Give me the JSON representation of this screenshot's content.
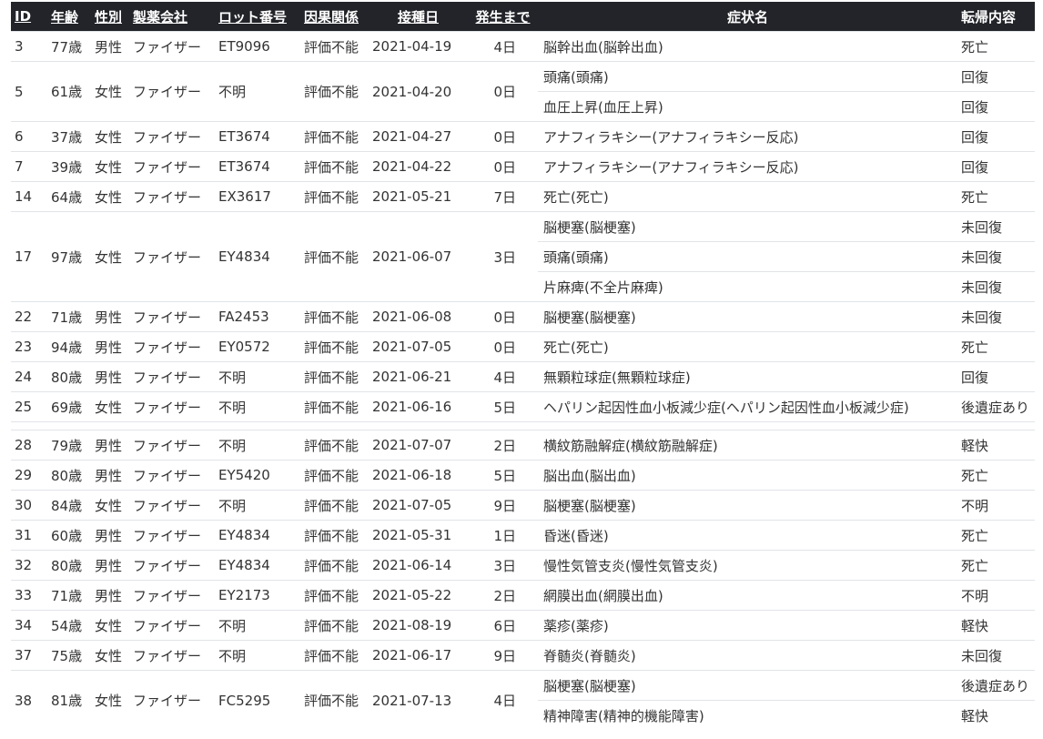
{
  "headers": {
    "id": "ID",
    "age": "年齢",
    "sex": "性別",
    "maker": "製薬会社",
    "lot": "ロット番号",
    "causality": "因果関係",
    "date": "接種日",
    "days": "発生まで",
    "symptom": "症状名",
    "outcome": "転帰内容"
  },
  "records": [
    {
      "id": "3",
      "age": "77歳",
      "sex": "男性",
      "maker": "ファイザー",
      "lot": "ET9096",
      "causality": "評価不能",
      "date": "2021-04-19",
      "days": "4日",
      "symptoms": [
        {
          "name": "脳幹出血(脳幹出血)",
          "outcome": "死亡"
        }
      ]
    },
    {
      "id": "5",
      "age": "61歳",
      "sex": "女性",
      "maker": "ファイザー",
      "lot": "不明",
      "causality": "評価不能",
      "date": "2021-04-20",
      "days": "0日",
      "symptoms": [
        {
          "name": "頭痛(頭痛)",
          "outcome": "回復"
        },
        {
          "name": "血圧上昇(血圧上昇)",
          "outcome": "回復"
        }
      ]
    },
    {
      "id": "6",
      "age": "37歳",
      "sex": "女性",
      "maker": "ファイザー",
      "lot": "ET3674",
      "causality": "評価不能",
      "date": "2021-04-27",
      "days": "0日",
      "symptoms": [
        {
          "name": "アナフィラキシー(アナフィラキシー反応)",
          "outcome": "回復"
        }
      ]
    },
    {
      "id": "7",
      "age": "39歳",
      "sex": "女性",
      "maker": "ファイザー",
      "lot": "ET3674",
      "causality": "評価不能",
      "date": "2021-04-22",
      "days": "0日",
      "symptoms": [
        {
          "name": "アナフィラキシー(アナフィラキシー反応)",
          "outcome": "回復"
        }
      ]
    },
    {
      "id": "14",
      "age": "64歳",
      "sex": "女性",
      "maker": "ファイザー",
      "lot": "EX3617",
      "causality": "評価不能",
      "date": "2021-05-21",
      "days": "7日",
      "symptoms": [
        {
          "name": "死亡(死亡)",
          "outcome": "死亡"
        }
      ]
    },
    {
      "id": "17",
      "age": "97歳",
      "sex": "女性",
      "maker": "ファイザー",
      "lot": "EY4834",
      "causality": "評価不能",
      "date": "2021-06-07",
      "days": "3日",
      "symptoms": [
        {
          "name": "脳梗塞(脳梗塞)",
          "outcome": "未回復"
        },
        {
          "name": "頭痛(頭痛)",
          "outcome": "未回復"
        },
        {
          "name": "片麻痺(不全片麻痺)",
          "outcome": "未回復"
        }
      ]
    },
    {
      "id": "22",
      "age": "71歳",
      "sex": "男性",
      "maker": "ファイザー",
      "lot": "FA2453",
      "causality": "評価不能",
      "date": "2021-06-08",
      "days": "0日",
      "symptoms": [
        {
          "name": "脳梗塞(脳梗塞)",
          "outcome": "未回復"
        }
      ]
    },
    {
      "id": "23",
      "age": "94歳",
      "sex": "男性",
      "maker": "ファイザー",
      "lot": "EY0572",
      "causality": "評価不能",
      "date": "2021-07-05",
      "days": "0日",
      "symptoms": [
        {
          "name": "死亡(死亡)",
          "outcome": "死亡"
        }
      ]
    },
    {
      "id": "24",
      "age": "80歳",
      "sex": "男性",
      "maker": "ファイザー",
      "lot": "不明",
      "causality": "評価不能",
      "date": "2021-06-21",
      "days": "4日",
      "symptoms": [
        {
          "name": "無顆粒球症(無顆粒球症)",
          "outcome": "回復"
        }
      ]
    },
    {
      "id": "25",
      "age": "69歳",
      "sex": "女性",
      "maker": "ファイザー",
      "lot": "不明",
      "causality": "評価不能",
      "date": "2021-06-16",
      "days": "5日",
      "symptoms": [
        {
          "name": "ヘパリン起因性血小板減少症(ヘパリン起因性血小板減少症)",
          "outcome": "後遺症あり"
        }
      ]
    },
    {
      "id": "28",
      "age": "79歳",
      "sex": "男性",
      "maker": "ファイザー",
      "lot": "不明",
      "causality": "評価不能",
      "date": "2021-07-07",
      "days": "2日",
      "symptoms": [
        {
          "name": "横紋筋融解症(横紋筋融解症)",
          "outcome": "軽快"
        }
      ]
    },
    {
      "id": "29",
      "age": "80歳",
      "sex": "男性",
      "maker": "ファイザー",
      "lot": "EY5420",
      "causality": "評価不能",
      "date": "2021-06-18",
      "days": "5日",
      "symptoms": [
        {
          "name": "脳出血(脳出血)",
          "outcome": "死亡"
        }
      ]
    },
    {
      "id": "30",
      "age": "84歳",
      "sex": "女性",
      "maker": "ファイザー",
      "lot": "不明",
      "causality": "評価不能",
      "date": "2021-07-05",
      "days": "9日",
      "symptoms": [
        {
          "name": "脳梗塞(脳梗塞)",
          "outcome": "不明"
        }
      ]
    },
    {
      "id": "31",
      "age": "60歳",
      "sex": "男性",
      "maker": "ファイザー",
      "lot": "EY4834",
      "causality": "評価不能",
      "date": "2021-05-31",
      "days": "1日",
      "symptoms": [
        {
          "name": "昏迷(昏迷)",
          "outcome": "死亡"
        }
      ]
    },
    {
      "id": "32",
      "age": "80歳",
      "sex": "男性",
      "maker": "ファイザー",
      "lot": "EY4834",
      "causality": "評価不能",
      "date": "2021-06-14",
      "days": "3日",
      "symptoms": [
        {
          "name": "慢性気管支炎(慢性気管支炎)",
          "outcome": "死亡"
        }
      ]
    },
    {
      "id": "33",
      "age": "71歳",
      "sex": "男性",
      "maker": "ファイザー",
      "lot": "EY2173",
      "causality": "評価不能",
      "date": "2021-05-22",
      "days": "2日",
      "symptoms": [
        {
          "name": "網膜出血(網膜出血)",
          "outcome": "不明"
        }
      ]
    },
    {
      "id": "34",
      "age": "54歳",
      "sex": "女性",
      "maker": "ファイザー",
      "lot": "不明",
      "causality": "評価不能",
      "date": "2021-08-19",
      "days": "6日",
      "symptoms": [
        {
          "name": "薬疹(薬疹)",
          "outcome": "軽快"
        }
      ]
    },
    {
      "id": "37",
      "age": "75歳",
      "sex": "女性",
      "maker": "ファイザー",
      "lot": "不明",
      "causality": "評価不能",
      "date": "2021-06-17",
      "days": "9日",
      "symptoms": [
        {
          "name": "脊髄炎(脊髄炎)",
          "outcome": "未回復"
        }
      ]
    },
    {
      "id": "38",
      "age": "81歳",
      "sex": "女性",
      "maker": "ファイザー",
      "lot": "FC5295",
      "causality": "評価不能",
      "date": "2021-07-13",
      "days": "4日",
      "symptoms": [
        {
          "name": "脳梗塞(脳梗塞)",
          "outcome": "後遺症あり"
        },
        {
          "name": "精神障害(精神的機能障害)",
          "outcome": "軽快"
        }
      ]
    }
  ]
}
